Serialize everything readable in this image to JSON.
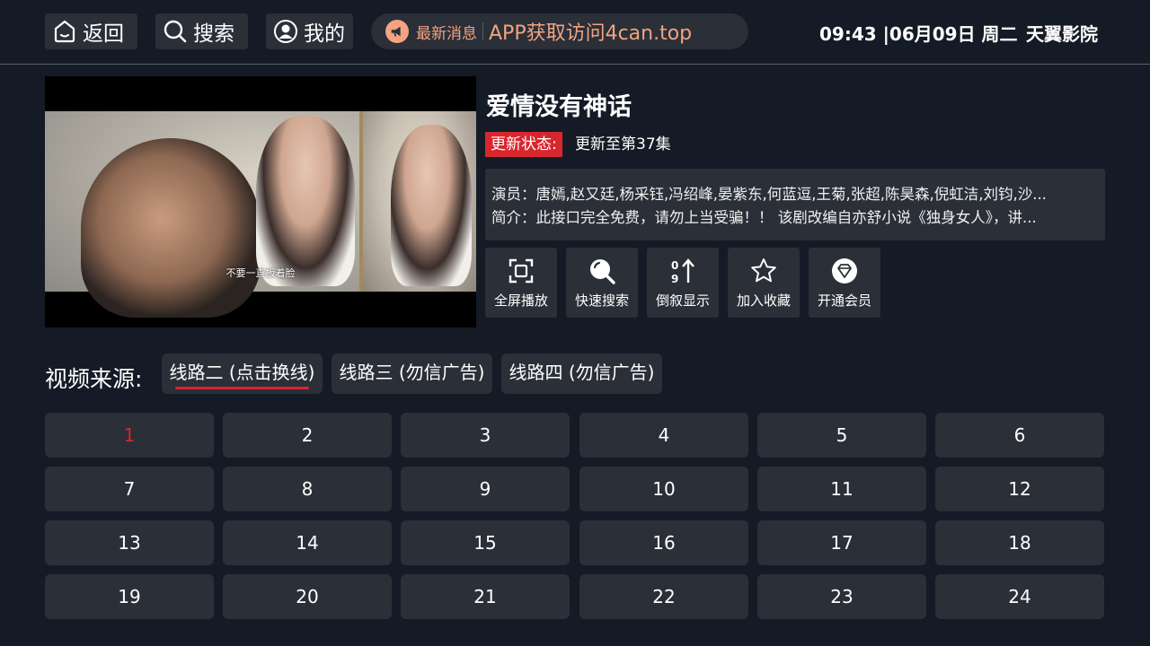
{
  "header": {
    "back_label": "返回",
    "search_label": "搜索",
    "me_label": "我的",
    "news_tag": "最新消息",
    "news_text": "APP获取访问4can.top",
    "clock": "09:43 |06月09日 周二",
    "brand": "天翼影院"
  },
  "player": {
    "subtitle": "不要一直板着脸"
  },
  "detail": {
    "title": "爱情没有神话",
    "status_label": "更新状态:",
    "status_value": "更新至第37集",
    "actors": "演员：唐嫣,赵又廷,杨采钰,冯绍峰,晏紫东,何蓝逗,王菊,张超,陈昊森,倪虹洁,刘钧,沙...",
    "intro": "简介：此接口完全免费，请勿上当受骗！！ 该剧改编自亦舒小说《独身女人》，讲..."
  },
  "actions": [
    {
      "label": "全屏播放",
      "icon": "fullscreen-icon"
    },
    {
      "label": "快速搜索",
      "icon": "magnifier-icon"
    },
    {
      "label": "倒叙显示",
      "icon": "sort-icon"
    },
    {
      "label": "加入收藏",
      "icon": "star-icon"
    },
    {
      "label": "开通会员",
      "icon": "diamond-icon"
    }
  ],
  "sources": {
    "label": "视频来源:",
    "tabs": [
      "线路二 (点击换线)",
      "线路三 (勿信广告)",
      "线路四 (勿信广告)"
    ],
    "selected": 0
  },
  "episodes": {
    "items": [
      "1",
      "2",
      "3",
      "4",
      "5",
      "6",
      "7",
      "8",
      "9",
      "10",
      "11",
      "12",
      "13",
      "14",
      "15",
      "16",
      "17",
      "18",
      "19",
      "20",
      "21",
      "22",
      "23",
      "24"
    ],
    "active": "1"
  },
  "colors": {
    "background": "#141b26",
    "panel": "#2a2f38",
    "accent_red": "#d8262e",
    "news_orange": "#f2a380"
  }
}
